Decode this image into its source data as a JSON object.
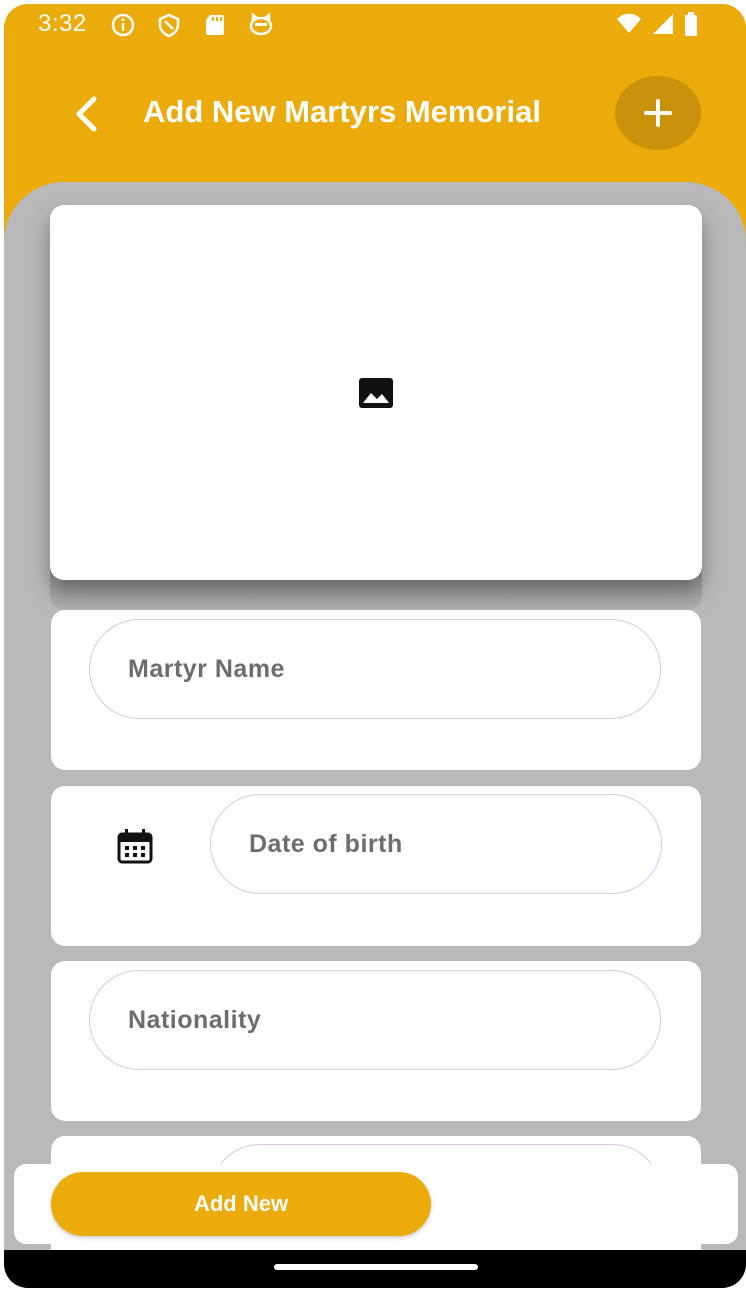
{
  "status_bar": {
    "time": "3:32",
    "left_icons": [
      "info-icon",
      "shield-icon",
      "sd-card-icon",
      "cat-face-icon"
    ],
    "right_icons": [
      "wifi-icon",
      "signal-icon",
      "battery-icon"
    ]
  },
  "app_bar": {
    "title": "Add New Martyrs Memorial",
    "back_icon": "chevron-left-icon",
    "action_icon": "plus-icon",
    "color": "#eaab0b"
  },
  "image_picker": {
    "icon": "image-icon"
  },
  "form": {
    "martyr_name_placeholder": "Martyr Name",
    "date_of_birth_placeholder": "Date of birth",
    "date_icon": "calendar-icon",
    "nationality_placeholder": "Nationality",
    "next_field_placeholder": ""
  },
  "footer": {
    "add_new_label": "Add New"
  },
  "colors": {
    "accent": "#eaab0b",
    "background": "#b9b9b9",
    "field_border": "#e0c2e6"
  }
}
